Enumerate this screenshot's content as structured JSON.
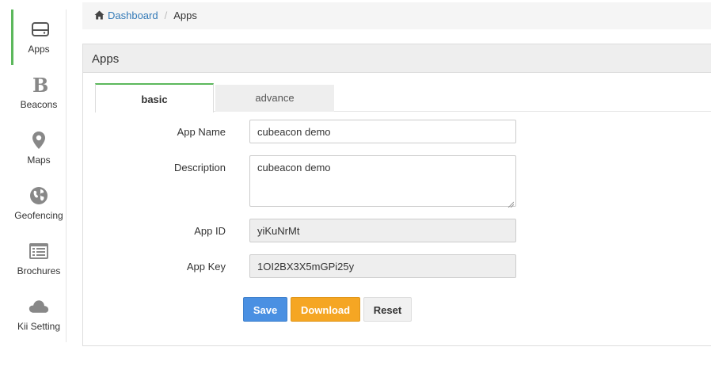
{
  "sidebar": {
    "items": [
      {
        "label": "Apps",
        "icon": "drive-icon"
      },
      {
        "label": "Beacons",
        "icon": "beacon-b-icon"
      },
      {
        "label": "Maps",
        "icon": "map-marker-icon"
      },
      {
        "label": "Geofencing",
        "icon": "globe-icon"
      },
      {
        "label": "Brochures",
        "icon": "list-alt-icon"
      },
      {
        "label": "Kii Setting",
        "icon": "cloud-icon"
      }
    ]
  },
  "breadcrumb": {
    "home_label": "Dashboard",
    "separator": "/",
    "current": "Apps"
  },
  "panel": {
    "title": "Apps",
    "tabs": [
      {
        "label": "basic",
        "active": true
      },
      {
        "label": "advance",
        "active": false
      }
    ],
    "fields": {
      "app_name": {
        "label": "App Name",
        "value": "cubeacon demo"
      },
      "description": {
        "label": "Description",
        "value": "cubeacon demo"
      },
      "app_id": {
        "label": "App ID",
        "value": "yiKuNrMt"
      },
      "app_key": {
        "label": "App Key",
        "value": "1OI2BX3X5mGPi25y"
      }
    },
    "buttons": {
      "save": "Save",
      "download": "Download",
      "reset": "Reset"
    }
  },
  "colors": {
    "accent_green": "#5cb85c",
    "link_blue": "#337ab7",
    "save_blue": "#4a90e2",
    "download_orange": "#f5a623",
    "icon_gray": "#777777"
  }
}
